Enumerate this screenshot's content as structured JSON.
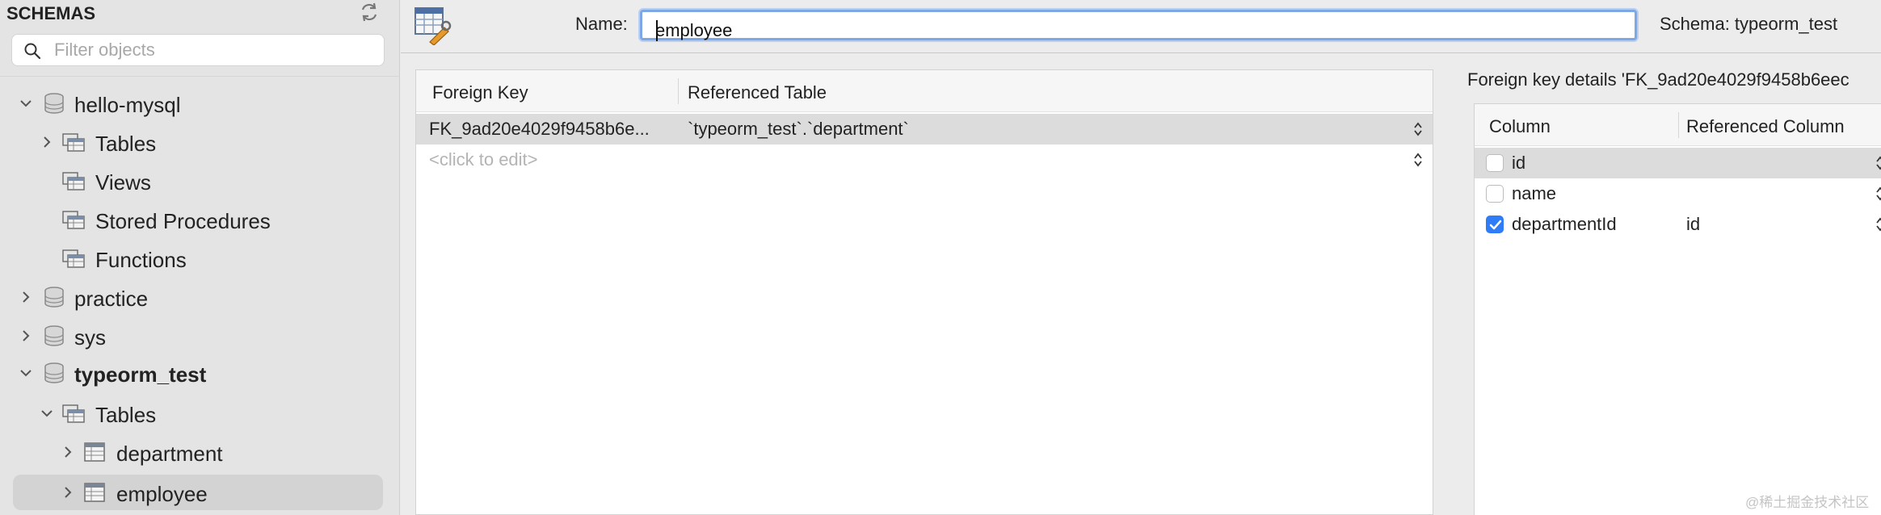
{
  "sidebar": {
    "title": "SCHEMAS",
    "search_placeholder": "Filter objects",
    "tree": [
      {
        "label": "hello-mysql",
        "kind": "schema",
        "expanded": true
      },
      {
        "label": "Tables",
        "kind": "folder",
        "expanded": false
      },
      {
        "label": "Views",
        "kind": "folder"
      },
      {
        "label": "Stored Procedures",
        "kind": "folder"
      },
      {
        "label": "Functions",
        "kind": "folder"
      },
      {
        "label": "practice",
        "kind": "schema",
        "expanded": false
      },
      {
        "label": "sys",
        "kind": "schema",
        "expanded": false
      },
      {
        "label": "typeorm_test",
        "kind": "schema",
        "expanded": true,
        "bold": true
      },
      {
        "label": "Tables",
        "kind": "folder",
        "expanded": true
      },
      {
        "label": "department",
        "kind": "table",
        "expanded": false
      },
      {
        "label": "employee",
        "kind": "table",
        "expanded": false,
        "selected": true
      }
    ]
  },
  "topbar": {
    "name_label": "Name:",
    "name_value": "employee",
    "schema_text": "Schema:  typeorm_test"
  },
  "fk_table": {
    "headers": [
      "Foreign Key",
      "Referenced Table"
    ],
    "rows": [
      {
        "fk": "FK_9ad20e4029f9458b6e...",
        "ref": "`typeorm_test`.`department`",
        "selected": true
      },
      {
        "fk": "<click to edit>",
        "ref": "",
        "placeholder": true
      }
    ]
  },
  "details": {
    "title": "Foreign key details 'FK_9ad20e4029f9458b6eec",
    "headers": [
      "Column",
      "Referenced Column"
    ],
    "rows": [
      {
        "column": "id",
        "ref": "",
        "checked": false,
        "selected": true
      },
      {
        "column": "name",
        "ref": "",
        "checked": false
      },
      {
        "column": "departmentId",
        "ref": "id",
        "checked": true
      }
    ]
  },
  "watermark": "@稀土掘金技术社区",
  "colors": {
    "accent": "#2e7cf6",
    "focus_ring": "#7ea7e6",
    "selection": "#dcdcdc"
  }
}
